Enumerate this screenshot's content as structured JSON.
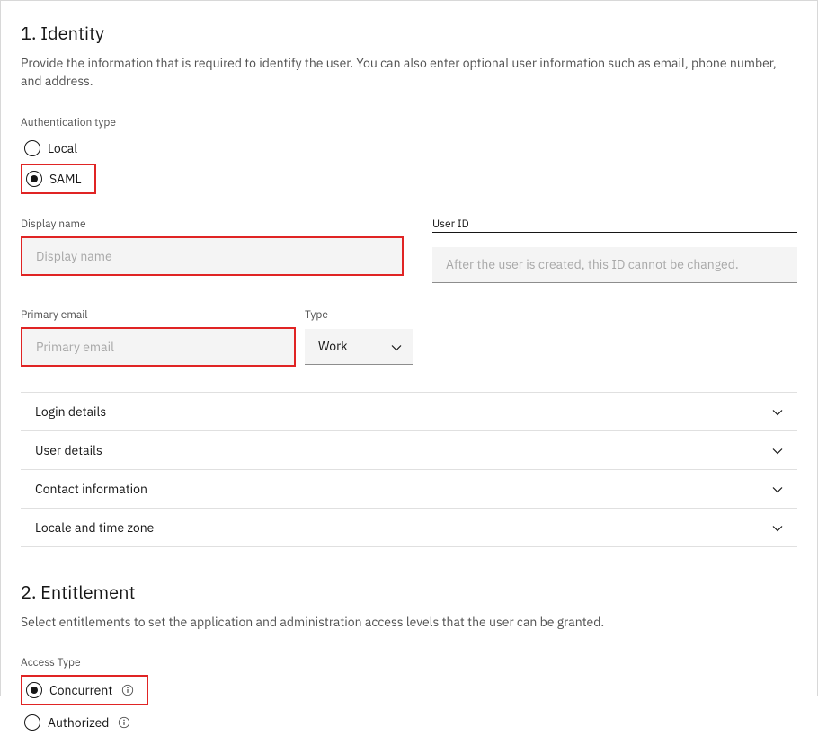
{
  "identity": {
    "title": "1. Identity",
    "description": "Provide the information that is required to identify the user. You can also enter optional user information such as email, phone number, and address.",
    "authTypeLabel": "Authentication type",
    "authOptions": {
      "local": "Local",
      "saml": "SAML"
    },
    "displayName": {
      "label": "Display name",
      "placeholder": "Display name"
    },
    "userId": {
      "label": "User ID",
      "placeholder": "After the user is created, this ID cannot be changed."
    },
    "primaryEmail": {
      "label": "Primary email",
      "placeholder": "Primary email"
    },
    "emailType": {
      "label": "Type",
      "selected": "Work"
    },
    "accordion": [
      "Login details",
      "User details",
      "Contact information",
      "Locale and time zone"
    ]
  },
  "entitlement": {
    "title": "2. Entitlement",
    "description": "Select entitlements to set the application and administration access levels that the user can be granted.",
    "accessTypeLabel": "Access Type",
    "options": {
      "concurrent": "Concurrent",
      "authorized": "Authorized"
    }
  }
}
